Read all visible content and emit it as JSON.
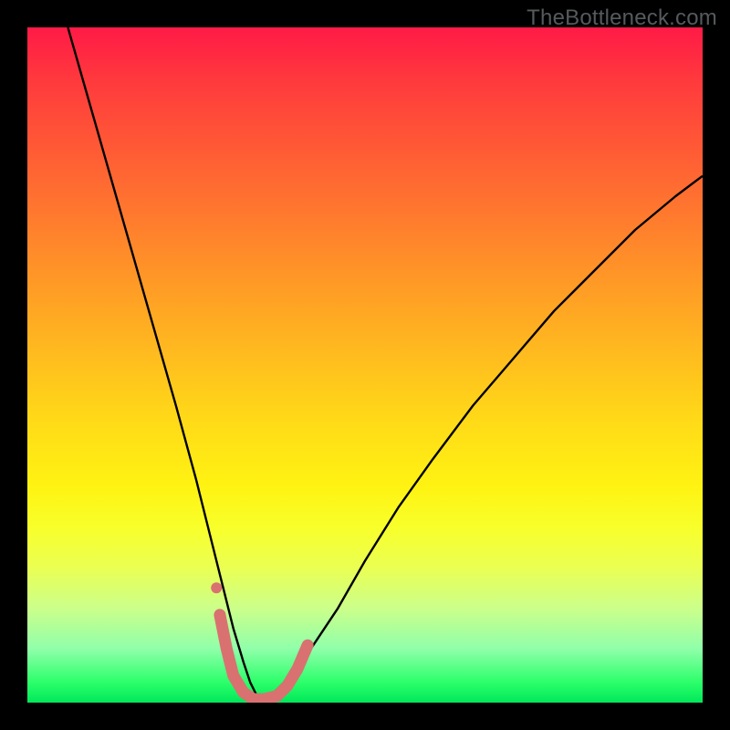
{
  "watermark": "TheBottleneck.com",
  "chart_data": {
    "type": "line",
    "title": "",
    "xlabel": "",
    "ylabel": "",
    "xlim": [
      0,
      100
    ],
    "ylim": [
      0,
      100
    ],
    "grid": false,
    "legend": false,
    "series": [
      {
        "name": "bottleneck-curve-black",
        "stroke": "#000000",
        "stroke_width": 2.4,
        "x": [
          6,
          10,
          14,
          18,
          22,
          25,
          27,
          29,
          30.5,
          32,
          33,
          34,
          35,
          38,
          42,
          46,
          50,
          55,
          60,
          66,
          72,
          78,
          84,
          90,
          96,
          100
        ],
        "values": [
          100,
          86,
          72,
          58,
          44,
          33,
          25,
          17,
          11,
          6,
          3,
          1,
          0,
          3,
          8,
          14,
          21,
          29,
          36,
          44,
          51,
          58,
          64,
          70,
          75,
          78
        ]
      },
      {
        "name": "bottleneck-highlight-salmon",
        "stroke": "#d97171",
        "stroke_width": 13,
        "stroke_linecap": "round",
        "x": [
          28.5,
          29.5,
          30.5,
          32,
          33.5,
          35,
          37,
          38.5,
          40,
          41.5
        ],
        "values": [
          13,
          8,
          4,
          1.5,
          0.5,
          0.5,
          1,
          2.5,
          5,
          8.5
        ]
      }
    ],
    "annotations": [
      {
        "name": "outlier-dot",
        "type": "marker",
        "x": 28,
        "y": 17,
        "radius": 6,
        "fill": "#d97171"
      }
    ],
    "colors": {
      "gradient_top": "#ff1a46",
      "gradient_bottom": "#00e85a",
      "curve_main": "#000000",
      "curve_highlight": "#d97171",
      "frame": "#000000",
      "watermark": "#555a5d"
    }
  }
}
